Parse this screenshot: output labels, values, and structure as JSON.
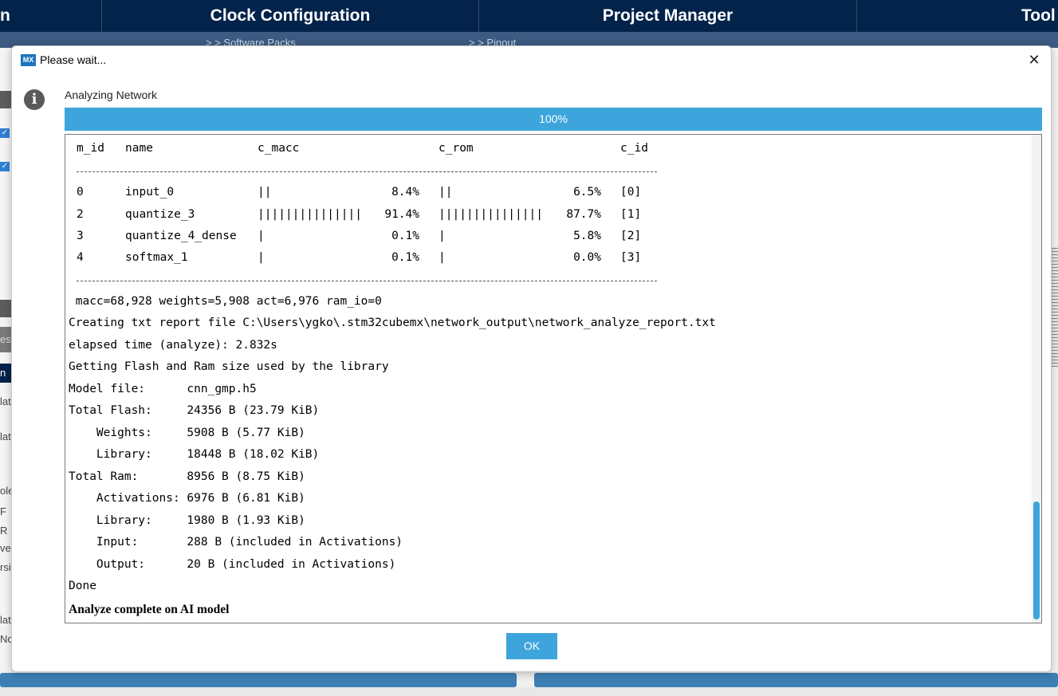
{
  "app": {
    "tabs": [
      "n",
      "Clock Configuration",
      "Project Manager",
      "Tool"
    ],
    "subtabs": [
      "> > Software Packs",
      "> > Pinout"
    ],
    "left_fragments": [
      "es",
      "n",
      "lat",
      "lat",
      "ole",
      "F",
      "R",
      "ve",
      "rsi",
      "lat",
      "No"
    ]
  },
  "dialog": {
    "icon_label": "MX",
    "title": "Please wait...",
    "close_glyph": "✕",
    "info_glyph": "i",
    "status": "Analyzing Network",
    "progress_text": "100%",
    "progress_value": 1.0,
    "ok_label": "OK"
  },
  "table": {
    "headers": [
      "m_id",
      "name",
      "c_macc",
      "c_rom",
      "c_id"
    ],
    "rows": [
      {
        "m_id": "0",
        "name": "input_0",
        "macc_bar": "||",
        "macc_pct": "8.4%",
        "rom_bar": "||",
        "rom_pct": "6.5%",
        "c_id": "[0]"
      },
      {
        "m_id": "2",
        "name": "quantize_3",
        "macc_bar": "|||||||||||||||",
        "macc_pct": "91.4%",
        "rom_bar": "|||||||||||||||",
        "rom_pct": "87.7%",
        "c_id": "[1]"
      },
      {
        "m_id": "3",
        "name": "quantize_4_dense",
        "macc_bar": "|",
        "macc_pct": "0.1%",
        "rom_bar": "|",
        "rom_pct": "5.8%",
        "c_id": "[2]"
      },
      {
        "m_id": "4",
        "name": "softmax_1",
        "macc_bar": "|",
        "macc_pct": "0.1%",
        "rom_bar": "|",
        "rom_pct": "0.0%",
        "c_id": "[3]"
      }
    ]
  },
  "log": [
    " macc=68,928 weights=5,908 act=6,976 ram_io=0",
    "Creating txt report file C:\\Users\\ygko\\.stm32cubemx\\network_output\\network_analyze_report.txt",
    "elapsed time (analyze): 2.832s",
    "Getting Flash and Ram size used by the library",
    "Model file:      cnn_gmp.h5",
    "Total Flash:     24356 B (23.79 KiB)",
    "    Weights:     5908 B (5.77 KiB)",
    "    Library:     18448 B (18.02 KiB)",
    "Total Ram:       8956 B (8.75 KiB)",
    "    Activations: 6976 B (6.81 KiB)",
    "    Library:     1980 B (1.93 KiB)",
    "    Input:       288 B (included in Activations)",
    "    Output:      20 B (included in Activations)",
    "Done"
  ],
  "final_message": "Analyze complete on AI model",
  "colors": {
    "header_bg": "#03234b",
    "accent": "#3da5dc"
  }
}
